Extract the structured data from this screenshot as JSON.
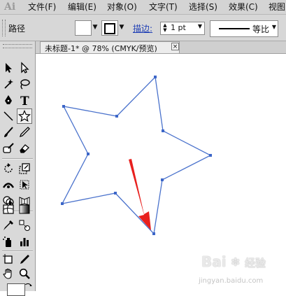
{
  "app": {
    "logo": "Ai"
  },
  "menu": {
    "items": [
      "文件(F)",
      "编辑(E)",
      "对象(O)",
      "文字(T)",
      "选择(S)",
      "效果(C)",
      "视图"
    ]
  },
  "control_bar": {
    "selection_label": "路径",
    "stroke_link_label": "描边:",
    "stroke_weight": "1 pt",
    "stroke_profile": "等比"
  },
  "document": {
    "tab_title": "未标题-1* @ 78% (CMYK/预览)",
    "close_glyph": "×"
  },
  "watermark": {
    "brand": "Bai",
    "brand_suffix": "经验",
    "url": "jingyan.baidu.com"
  },
  "colors": {
    "path_stroke": "#4a72cc",
    "anchor_fill": "#3c66c8",
    "arrow": "#e8201e",
    "stroke_link": "#1f3fb5"
  },
  "icons": {
    "tools": [
      "selection-tool-icon",
      "direct-selection-tool-icon",
      "magic-wand-tool-icon",
      "lasso-tool-icon",
      "pen-tool-icon",
      "type-tool-icon",
      "line-segment-tool-icon",
      "star-tool-icon",
      "paintbrush-tool-icon",
      "pencil-tool-icon",
      "blob-brush-tool-icon",
      "eraser-tool-icon",
      "rotate-tool-icon",
      "scale-tool-icon",
      "width-tool-icon",
      "free-transform-tool-icon",
      "shape-builder-tool-icon",
      "perspective-grid-tool-icon",
      "mesh-tool-icon",
      "gradient-tool-icon",
      "eyedropper-tool-icon",
      "blend-tool-icon",
      "symbol-sprayer-tool-icon",
      "column-graph-tool-icon",
      "artboard-tool-icon",
      "slice-tool-icon",
      "hand-tool-icon",
      "zoom-tool-icon"
    ],
    "active_tool": "star-tool-icon"
  }
}
